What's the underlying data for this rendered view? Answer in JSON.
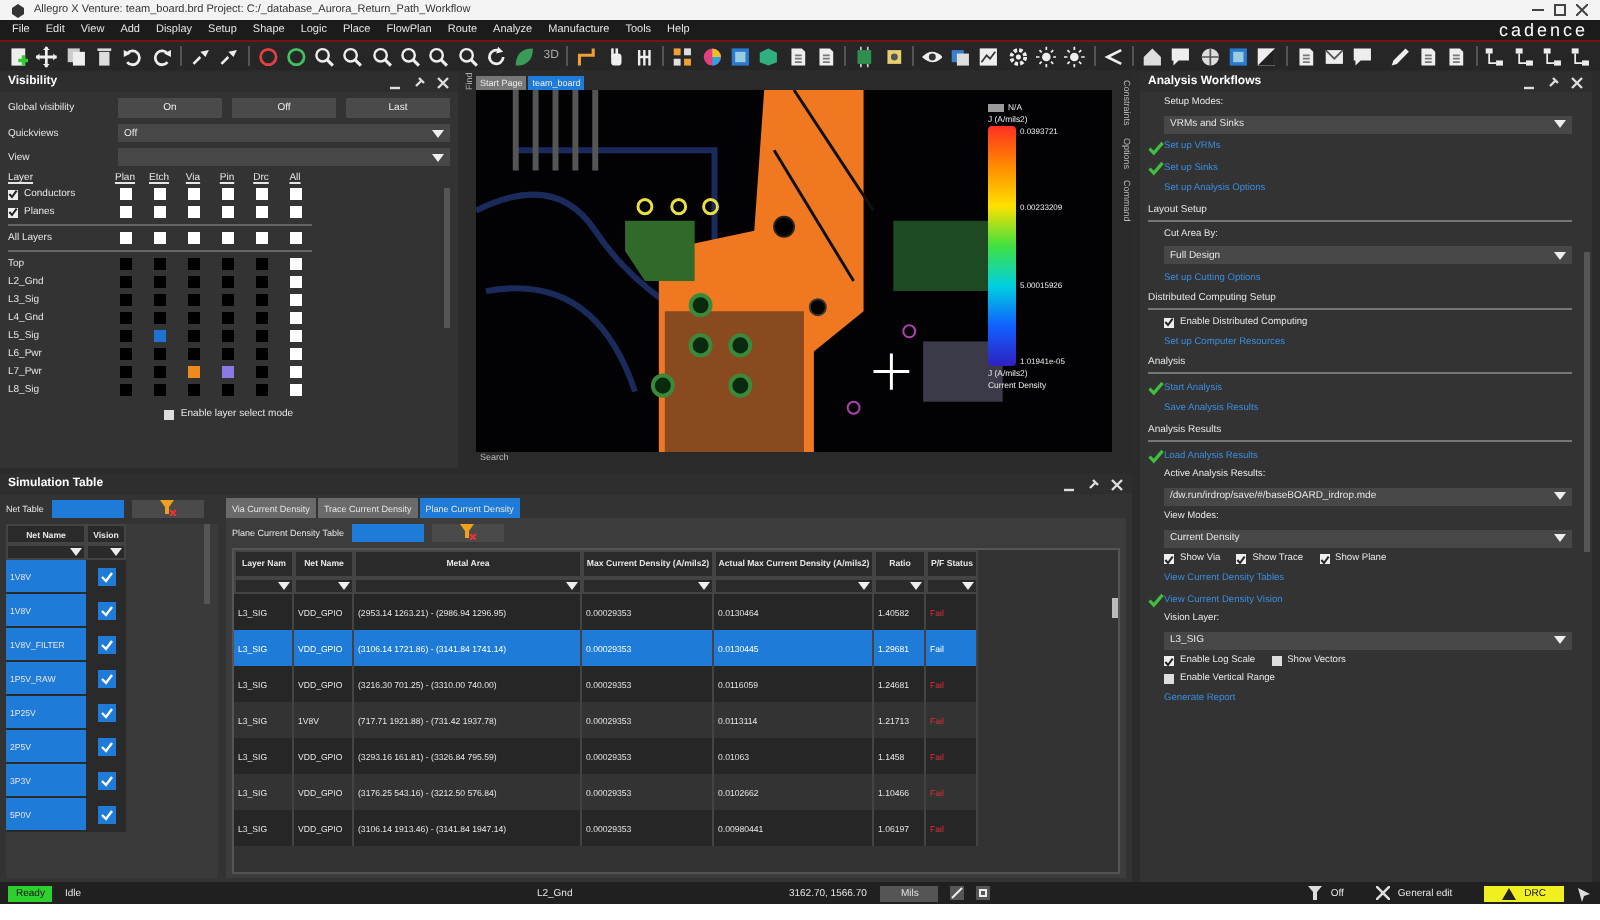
{
  "window": {
    "title": "Allegro X Venture: team_board.brd  Project: C:/_database_Aurora_Return_Path_Workflow",
    "brand": "cadence"
  },
  "menu": [
    "File",
    "Edit",
    "View",
    "Add",
    "Display",
    "Setup",
    "Shape",
    "Logic",
    "Place",
    "FlowPlan",
    "Route",
    "Analyze",
    "Manufacture",
    "Tools",
    "Help"
  ],
  "toolbar": {
    "label": "3D"
  },
  "visibility": {
    "title": "Visibility",
    "global_label": "Global visibility",
    "global_buttons": [
      "On",
      "Off",
      "Last"
    ],
    "quickviews": {
      "label": "Quickviews",
      "value": "Off"
    },
    "view": {
      "label": "View"
    },
    "columns": [
      "Layer",
      "Plan",
      "Etch",
      "Via",
      "Pin",
      "Drc",
      "All"
    ],
    "groups": [
      {
        "label": "Conductors",
        "checked": true,
        "cells": [
          {
            "checked": false
          },
          {
            "checked": false
          },
          {
            "checked": false
          },
          {
            "checked": false
          },
          {
            "checked": false
          },
          {
            "checked": false
          }
        ]
      },
      {
        "label": "Planes",
        "checked": true,
        "cells": [
          {
            "checked": false
          },
          {
            "checked": false
          },
          {
            "checked": false
          },
          {
            "checked": false
          },
          {
            "checked": false
          },
          {
            "checked": false
          }
        ]
      }
    ],
    "all_layers": {
      "label": "All Layers",
      "cells": [
        {
          "checked": false
        },
        {
          "checked": false
        },
        {
          "checked": false
        },
        {
          "checked": false
        },
        {
          "checked": false
        },
        {
          "checked": false
        }
      ]
    },
    "layers": [
      {
        "name": "Top",
        "cells": [
          {
            "color": "#000000"
          },
          {
            "color": "#000000"
          },
          {
            "color": "#000000"
          },
          {
            "color": "#000000"
          },
          {
            "color": "#000000"
          }
        ],
        "all": false
      },
      {
        "name": "L2_Gnd",
        "cells": [
          {
            "color": "#000000"
          },
          {
            "color": "#000000"
          },
          {
            "color": "#000000"
          },
          {
            "color": "#000000"
          },
          {
            "color": "#000000"
          }
        ],
        "all": false
      },
      {
        "name": "L3_Sig",
        "cells": [
          {
            "color": "#000000"
          },
          {
            "color": "#000000"
          },
          {
            "color": "#000000"
          },
          {
            "color": "#000000"
          },
          {
            "color": "#000000"
          }
        ],
        "all": false
      },
      {
        "name": "L4_Gnd",
        "cells": [
          {
            "color": "#000000"
          },
          {
            "color": "#000000"
          },
          {
            "color": "#000000"
          },
          {
            "color": "#000000"
          },
          {
            "color": "#000000"
          }
        ],
        "all": false
      },
      {
        "name": "L5_Sig",
        "cells": [
          {
            "color": "#000000"
          },
          {
            "color": "#1e73d2"
          },
          {
            "color": "#000000"
          },
          {
            "color": "#000000"
          },
          {
            "color": "#000000"
          }
        ],
        "all": false
      },
      {
        "name": "L6_Pwr",
        "cells": [
          {
            "color": "#000000"
          },
          {
            "color": "#000000"
          },
          {
            "color": "#000000"
          },
          {
            "color": "#000000"
          },
          {
            "color": "#000000"
          }
        ],
        "all": false
      },
      {
        "name": "L7_Pwr",
        "cells": [
          {
            "color": "#000000"
          },
          {
            "color": "#000000"
          },
          {
            "color": "#f08a1c"
          },
          {
            "color": "#8a7ae6"
          },
          {
            "color": "#000000"
          }
        ],
        "all": false
      },
      {
        "name": "L8_Sig",
        "cells": [
          {
            "color": "#000000"
          },
          {
            "color": "#000000"
          },
          {
            "color": "#000000"
          },
          {
            "color": "#000000"
          },
          {
            "color": "#000000"
          }
        ],
        "all": false
      }
    ],
    "select_mode": {
      "label": "Enable layer select mode",
      "checked": false
    }
  },
  "canvas": {
    "tabs": [
      {
        "label": "Start Page",
        "selected": false
      },
      {
        "label": "team_board",
        "selected": true
      }
    ],
    "side_tab": "Find",
    "right_tabs": [
      "Constraints",
      "Options",
      "Command"
    ],
    "legend": {
      "na": "N/A",
      "unit_top": "J (A/mils2)",
      "ticks": [
        "0.0393721",
        "0.00233209",
        "5.00015926",
        "1.01941e-05"
      ],
      "unit_bottom": "J (A/mils2)",
      "caption": "Current Density"
    },
    "search": "Search"
  },
  "workflows": {
    "title": "Analysis Workflows",
    "items": [
      {
        "kind": "label",
        "text": "Setup Modes:"
      },
      {
        "kind": "dropdown",
        "value": "VRMs and Sinks"
      },
      {
        "kind": "link",
        "text": "Set up VRMs",
        "done": true
      },
      {
        "kind": "link",
        "text": "Set up Sinks",
        "done": true
      },
      {
        "kind": "link",
        "text": "Set up Analysis Options",
        "done": false
      },
      {
        "kind": "section",
        "text": "Layout Setup"
      },
      {
        "kind": "label",
        "text": "Cut Area By:"
      },
      {
        "kind": "dropdown",
        "value": "Full Design"
      },
      {
        "kind": "link",
        "text": "Set up Cutting Options",
        "done": false
      },
      {
        "kind": "section",
        "text": "Distributed Computing Setup"
      },
      {
        "kind": "checks",
        "items": [
          {
            "label": "Enable Distributed Computing",
            "checked": true
          }
        ]
      },
      {
        "kind": "link",
        "text": "Set up Computer Resources",
        "done": false
      },
      {
        "kind": "section",
        "text": "Analysis"
      },
      {
        "kind": "link",
        "text": "Start Analysis",
        "done": true
      },
      {
        "kind": "link",
        "text": "Save Analysis Results",
        "done": false
      },
      {
        "kind": "section",
        "text": "Analysis Results"
      },
      {
        "kind": "link",
        "text": "Load Analysis Results",
        "done": true
      },
      {
        "kind": "label",
        "text": "Active Analysis Results:"
      },
      {
        "kind": "dropdown",
        "value": "/dw.run/irdrop/save/#/baseBOARD_irdrop.mde"
      },
      {
        "kind": "label",
        "text": "View Modes:"
      },
      {
        "kind": "dropdown",
        "value": "Current Density"
      },
      {
        "kind": "checks",
        "items": [
          {
            "label": "Show Via",
            "checked": true
          },
          {
            "label": "Show Trace",
            "checked": true
          },
          {
            "label": "Show Plane",
            "checked": true
          }
        ]
      },
      {
        "kind": "link",
        "text": "View Current Density Tables",
        "done": false
      },
      {
        "kind": "link",
        "text": "View Current Density Vision",
        "done": true
      },
      {
        "kind": "label",
        "text": "Vision Layer:"
      },
      {
        "kind": "dropdown",
        "value": "L3_SIG"
      },
      {
        "kind": "checks",
        "items": [
          {
            "label": "Enable Log Scale",
            "checked": true
          },
          {
            "label": "Show Vectors",
            "checked": false
          }
        ]
      },
      {
        "kind": "checks",
        "items": [
          {
            "label": "Enable Vertical Range",
            "checked": false
          }
        ]
      },
      {
        "kind": "link",
        "text": "Generate Report",
        "done": false
      }
    ]
  },
  "simulation": {
    "title": "Simulation Table",
    "net_filter_label": "Net Table",
    "net_columns": [
      "Net Name",
      "Vision"
    ],
    "nets": [
      {
        "name": "1V8V",
        "selected": true,
        "vision": true
      },
      {
        "name": "1V8V",
        "selected": true,
        "vision": true
      },
      {
        "name": "1V8V_FILTER",
        "selected": true,
        "vision": true
      },
      {
        "name": "1P5V_RAW",
        "selected": true,
        "vision": true
      },
      {
        "name": "1P25V",
        "selected": true,
        "vision": true
      },
      {
        "name": "2P5V",
        "selected": true,
        "vision": true
      },
      {
        "name": "3P3V",
        "selected": true,
        "vision": true
      },
      {
        "name": "5P0V",
        "selected": true,
        "vision": true
      }
    ],
    "tabs": [
      {
        "label": "Via Current Density",
        "selected": false
      },
      {
        "label": "Trace Current Density",
        "selected": false
      },
      {
        "label": "Plane Current Density",
        "selected": true
      }
    ],
    "table_label": "Plane Current Density Table",
    "columns": [
      "Layer Nam",
      "Net Name",
      "Metal Area",
      "Max Current Density (A/mils2)",
      "Actual Max Current Density (A/mils2)",
      "Ratio",
      "P/F Status"
    ],
    "rows": [
      {
        "cells": [
          "L3_SIG",
          "VDD_GPIO",
          "(2953.14 1263.21) - (2986.94 1296.95)",
          "0.00029353",
          "0.0130464",
          "1.40582",
          "Fail"
        ],
        "pass": false,
        "selected": false
      },
      {
        "cells": [
          "L3_SIG",
          "VDD_GPIO",
          "(3106.14 1721.86) - (3141.84 1741.14)",
          "0.00029353",
          "0.0130445",
          "1.29681",
          "Fail"
        ],
        "pass": false,
        "selected": true
      },
      {
        "cells": [
          "L3_SIG",
          "VDD_GPIO",
          "(3216.30 701.25) - (3310.00 740.00)",
          "0.00029353",
          "0.0116059",
          "1.24681",
          "Fail"
        ],
        "pass": false,
        "selected": false
      },
      {
        "cells": [
          "L3_SIG",
          "1V8V",
          "(717.71 1921.88) - (731.42 1937.78)",
          "0.00029353",
          "0.0113114",
          "1.21713",
          "Fail"
        ],
        "pass": false,
        "selected": false
      },
      {
        "cells": [
          "L3_SIG",
          "VDD_GPIO",
          "(3293.16 161.81) - (3326.84 795.59)",
          "0.00029353",
          "0.01063",
          "1.1458",
          "Fail"
        ],
        "pass": false,
        "selected": false
      },
      {
        "cells": [
          "L3_SIG",
          "VDD_GPIO",
          "(3176.25 543.16) - (3212.50 576.84)",
          "0.00029353",
          "0.0102662",
          "1.10466",
          "Fail"
        ],
        "pass": false,
        "selected": false
      },
      {
        "cells": [
          "L3_SIG",
          "VDD_GPIO",
          "(3106.14 1913.46) - (3141.84 1947.14)",
          "0.00029353",
          "0.00980441",
          "1.06197",
          "Fail"
        ],
        "pass": false,
        "selected": false
      }
    ]
  },
  "status_bar": {
    "ready": "Ready",
    "mode": "Idle",
    "layer": "L2_Gnd",
    "coords": "3162.70, 1566.70",
    "units": "Mils",
    "filter": "Off",
    "edit": "General edit",
    "drc": "DRC"
  }
}
